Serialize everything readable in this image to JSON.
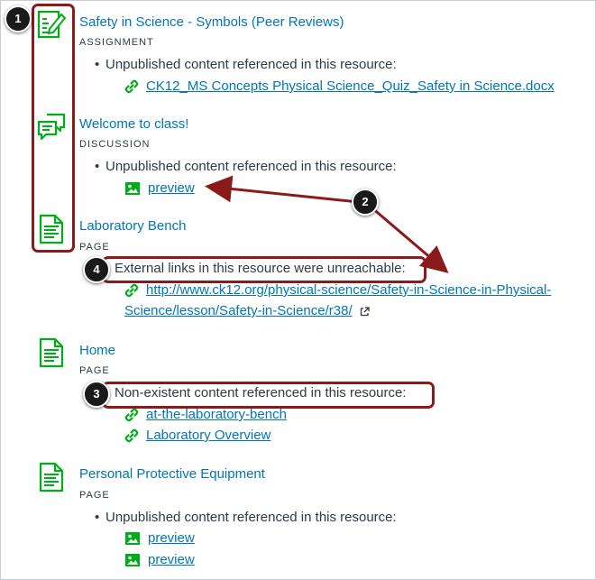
{
  "resources": [
    {
      "title": "Safety in Science - Symbols (Peer Reviews)",
      "type": "ASSIGNMENT",
      "icon": "assignment-icon",
      "issue": "Unpublished content referenced in this resource:",
      "links": [
        "CK12_MS Concepts Physical Science_Quiz_Safety in Science.docx"
      ]
    },
    {
      "title": "Welcome to class!",
      "type": "DISCUSSION",
      "icon": "discussion-icon",
      "issue": "Unpublished content referenced in this resource:",
      "links": [
        "preview"
      ]
    },
    {
      "title": "Laboratory Bench",
      "type": "PAGE",
      "icon": "page-icon",
      "issue": "External links in this resource were unreachable:",
      "links": [
        "http://www.ck12.org/physical-science/Safety-in-Science-in-Physical-",
        "Science/lesson/Safety-in-Science/r38/"
      ]
    },
    {
      "title": "Home",
      "type": "PAGE",
      "icon": "page-icon",
      "issue": "Non-existent content referenced in this resource:",
      "links": [
        "at-the-laboratory-bench",
        "Laboratory Overview"
      ]
    },
    {
      "title": "Personal Protective Equipment",
      "type": "PAGE",
      "icon": "page-icon",
      "issue": "Unpublished content referenced in this resource:",
      "links": [
        "preview",
        "preview"
      ]
    }
  ],
  "callouts": [
    "1",
    "2",
    "3",
    "4"
  ],
  "colors": {
    "link": "#0076b8",
    "icon_green": "#00ac18",
    "highlight": "#8b1a1a",
    "text": "#2d3b45"
  }
}
